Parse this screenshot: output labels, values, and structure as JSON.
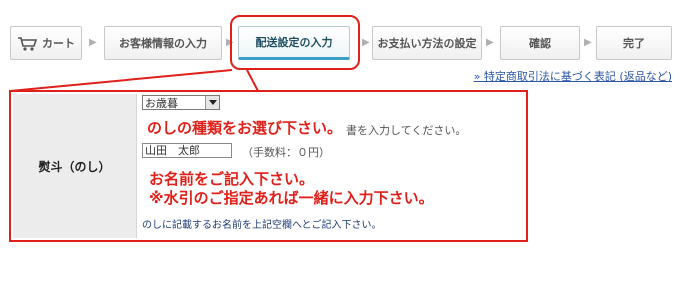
{
  "steps": [
    {
      "label": "カート",
      "active": false
    },
    {
      "label": "お客様情報の入力",
      "active": false
    },
    {
      "label": "配送設定の入力",
      "active": true
    },
    {
      "label": "お支払い方法の設定",
      "active": false
    },
    {
      "label": "確認",
      "active": false
    },
    {
      "label": "完了",
      "active": false
    }
  ],
  "legal_link": "» 特定商取引法に基づく表記 (返品など)",
  "form": {
    "label": "熨斗（のし）",
    "noshi_select_value": "お歳暮",
    "annotation_select": "のしの種類をお選び下さい。",
    "instruction_tail": "書を入力してください。",
    "name_value": "山田　太郎",
    "fee_text": "（手数料：０円）",
    "annotation_name_1": "お名前をご記入下さい。",
    "annotation_name_2": "※水引のご指定あれば一緒に入力下さい。",
    "note_text": "のしに記載するお名前を上記空欄へとご記入下さい。"
  },
  "colors": {
    "highlight": "#e0201a",
    "active_step_underline": "#3aa0c8",
    "link": "#2a55a8"
  }
}
